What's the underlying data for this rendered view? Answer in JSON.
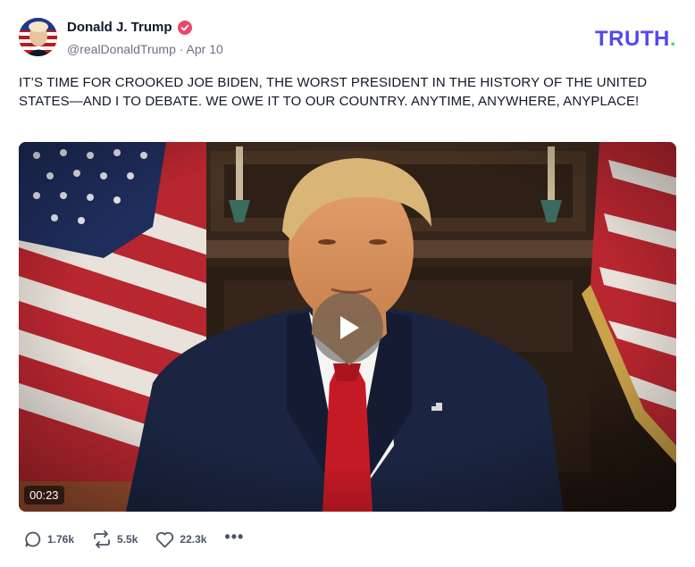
{
  "author": {
    "name": "Donald J. Trump",
    "handle": "@realDonaldTrump",
    "separator": "·",
    "date": "Apr 10"
  },
  "logo": {
    "text": "TRUTH",
    "dot": ".",
    "color": "#5448ee",
    "dot_color": "#4ade80"
  },
  "post": {
    "text": "IT’S TIME FOR CROOKED JOE BIDEN, THE WORST PRESIDENT IN THE HISTORY OF THE UNITED STATES—AND I TO DEBATE. WE OWE IT TO OUR COUNTRY. ANYTIME, ANYWHERE, ANYPLACE!"
  },
  "video": {
    "duration": "00:23"
  },
  "actions": {
    "replies": "1.76k",
    "retruths": "5.5k",
    "likes": "22.3k",
    "more": "•••"
  },
  "icons": {
    "verified": "verified-badge-icon",
    "reply": "reply-bubble-icon",
    "retruth": "retruth-arrows-icon",
    "like": "heart-icon",
    "play": "play-icon"
  }
}
